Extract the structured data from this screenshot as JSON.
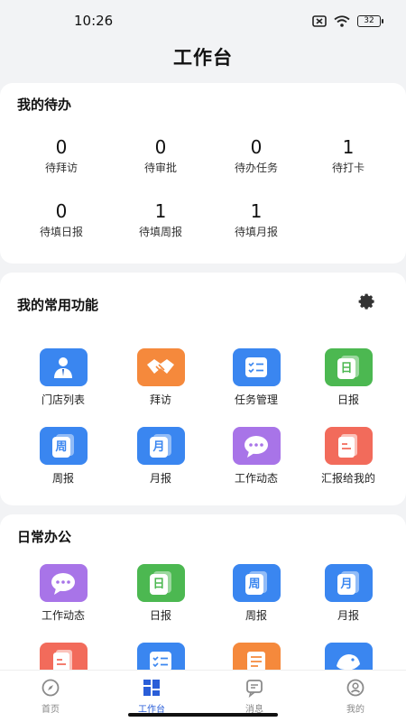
{
  "status": {
    "time": "10:26",
    "battery": "32"
  },
  "header": {
    "title": "工作台"
  },
  "todo": {
    "title": "我的待办",
    "items": [
      {
        "count": "0",
        "label": "待拜访"
      },
      {
        "count": "0",
        "label": "待审批"
      },
      {
        "count": "0",
        "label": "待办任务"
      },
      {
        "count": "1",
        "label": "待打卡"
      },
      {
        "count": "0",
        "label": "待填日报"
      },
      {
        "count": "1",
        "label": "待填周报"
      },
      {
        "count": "1",
        "label": "待填月报"
      }
    ]
  },
  "favorites": {
    "title": "我的常用功能",
    "items": [
      {
        "label": "门店列表",
        "icon": "store-list-icon",
        "glyph": "",
        "color": "#3a86f0"
      },
      {
        "label": "拜访",
        "icon": "handshake-icon",
        "glyph": "",
        "color": "#f5893c"
      },
      {
        "label": "任务管理",
        "icon": "task-icon",
        "glyph": "",
        "color": "#3a86f0"
      },
      {
        "label": "日报",
        "icon": "daily-report-icon",
        "glyph": "日",
        "color": "#4cb851"
      },
      {
        "label": "周报",
        "icon": "weekly-report-icon",
        "glyph": "周",
        "color": "#3a86f0"
      },
      {
        "label": "月报",
        "icon": "monthly-report-icon",
        "glyph": "月",
        "color": "#3a86f0"
      },
      {
        "label": "工作动态",
        "icon": "chat-icon",
        "glyph": "",
        "color": "#a874e8"
      },
      {
        "label": "汇报给我的",
        "icon": "report-to-me-icon",
        "glyph": "",
        "color": "#f26b5b"
      }
    ]
  },
  "office": {
    "title": "日常办公",
    "items": [
      {
        "label": "工作动态",
        "icon": "chat-icon",
        "glyph": "",
        "color": "#a874e8"
      },
      {
        "label": "日报",
        "icon": "daily-report-icon",
        "glyph": "日",
        "color": "#4cb851"
      },
      {
        "label": "周报",
        "icon": "weekly-report-icon",
        "glyph": "周",
        "color": "#3a86f0"
      },
      {
        "label": "月报",
        "icon": "monthly-report-icon",
        "glyph": "月",
        "color": "#3a86f0"
      },
      {
        "label": "",
        "icon": "document-icon",
        "glyph": "",
        "color": "#f26b5b"
      },
      {
        "label": "",
        "icon": "checklist-icon",
        "glyph": "",
        "color": "#3a86f0"
      },
      {
        "label": "",
        "icon": "list-icon",
        "glyph": "",
        "color": "#f5893c"
      },
      {
        "label": "",
        "icon": "bird-icon",
        "glyph": "",
        "color": "#3a86f0"
      }
    ]
  },
  "tabs": [
    {
      "label": "首页",
      "icon": "compass-icon",
      "active": false
    },
    {
      "label": "工作台",
      "icon": "dashboard-icon",
      "active": true
    },
    {
      "label": "消息",
      "icon": "message-icon",
      "active": false
    },
    {
      "label": "我的",
      "icon": "profile-icon",
      "active": false
    }
  ],
  "colors": {
    "accent": "#2a5ed8"
  }
}
